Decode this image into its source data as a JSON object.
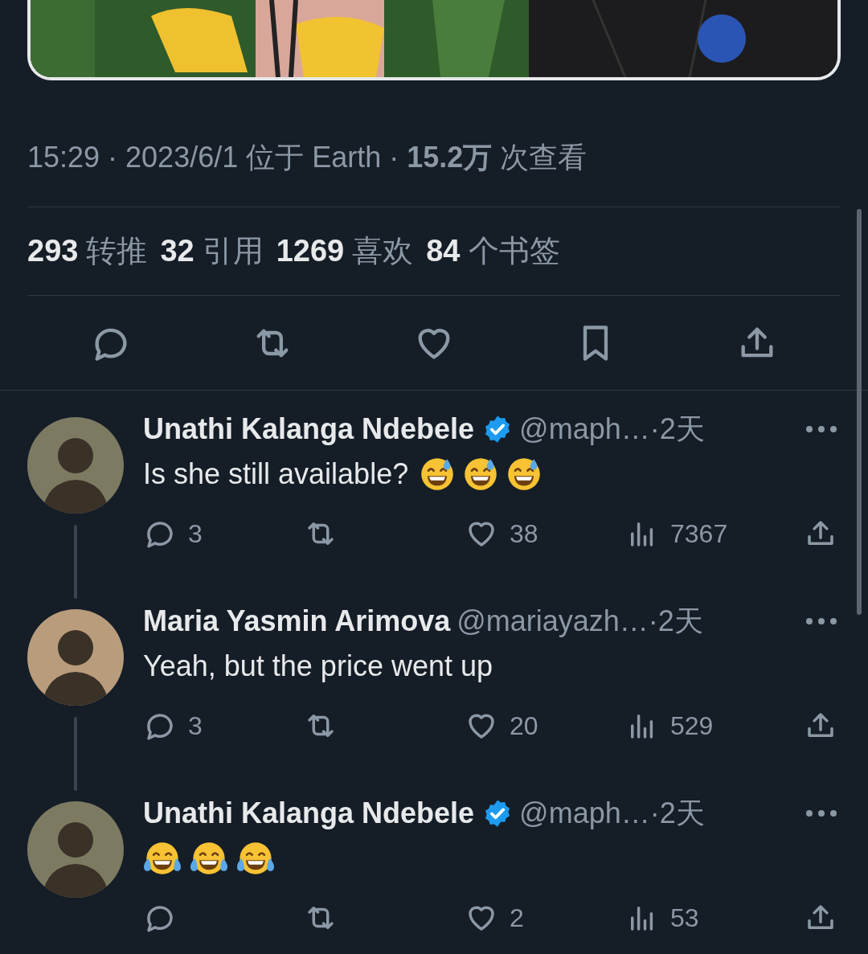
{
  "meta": "15:29 · 2023/6/1 位于 Earth · **15.2万** 次查看",
  "stats": [
    {
      "count": "293",
      "label": "转推"
    },
    {
      "count": "32",
      "label": "引用"
    },
    {
      "count": "1269",
      "label": "喜欢"
    },
    {
      "count": "84",
      "label": "个书签"
    }
  ],
  "actions": [
    {
      "kind": "reply"
    },
    {
      "kind": "repost"
    },
    {
      "kind": "like"
    },
    {
      "kind": "bookmark"
    },
    {
      "kind": "share"
    }
  ],
  "replies": [
    {
      "color": "#7d7a62",
      "name": "Unathi Kalanga Ndebele",
      "verified": true,
      "handle": "@maph…",
      "time": "·2天",
      "text": "Is she still available?",
      "emojis": [
        {
          "kind": "sweat-smile"
        },
        {
          "kind": "sweat-smile"
        },
        {
          "kind": "sweat-smile"
        }
      ],
      "thread_below": true,
      "actions": [
        {
          "kind": "reply",
          "count": "3"
        },
        {
          "kind": "repost"
        },
        {
          "kind": "like",
          "count": "38"
        },
        {
          "kind": "views",
          "count": "7367"
        },
        {
          "kind": "share"
        }
      ]
    },
    {
      "color": "#b89c7c",
      "name": "Maria Yasmin Arimova",
      "verified": false,
      "handle": "@mariayazh…",
      "time": "·2天",
      "text": "Yeah, but the price went up",
      "thread_below": true,
      "actions": [
        {
          "kind": "reply",
          "count": "3"
        },
        {
          "kind": "repost"
        },
        {
          "kind": "like",
          "count": "20"
        },
        {
          "kind": "views",
          "count": "529"
        },
        {
          "kind": "share"
        }
      ]
    },
    {
      "color": "#7d7a62",
      "name": "Unathi Kalanga Ndebele",
      "verified": true,
      "handle": "@maph…",
      "time": "·2天",
      "emojis": [
        {
          "kind": "tears-of-joy"
        },
        {
          "kind": "tears-of-joy"
        },
        {
          "kind": "tears-of-joy"
        }
      ],
      "thread_below": false,
      "actions": [
        {
          "kind": "reply"
        },
        {
          "kind": "repost"
        },
        {
          "kind": "like",
          "count": "2"
        },
        {
          "kind": "views",
          "count": "53"
        },
        {
          "kind": "share"
        }
      ]
    }
  ]
}
